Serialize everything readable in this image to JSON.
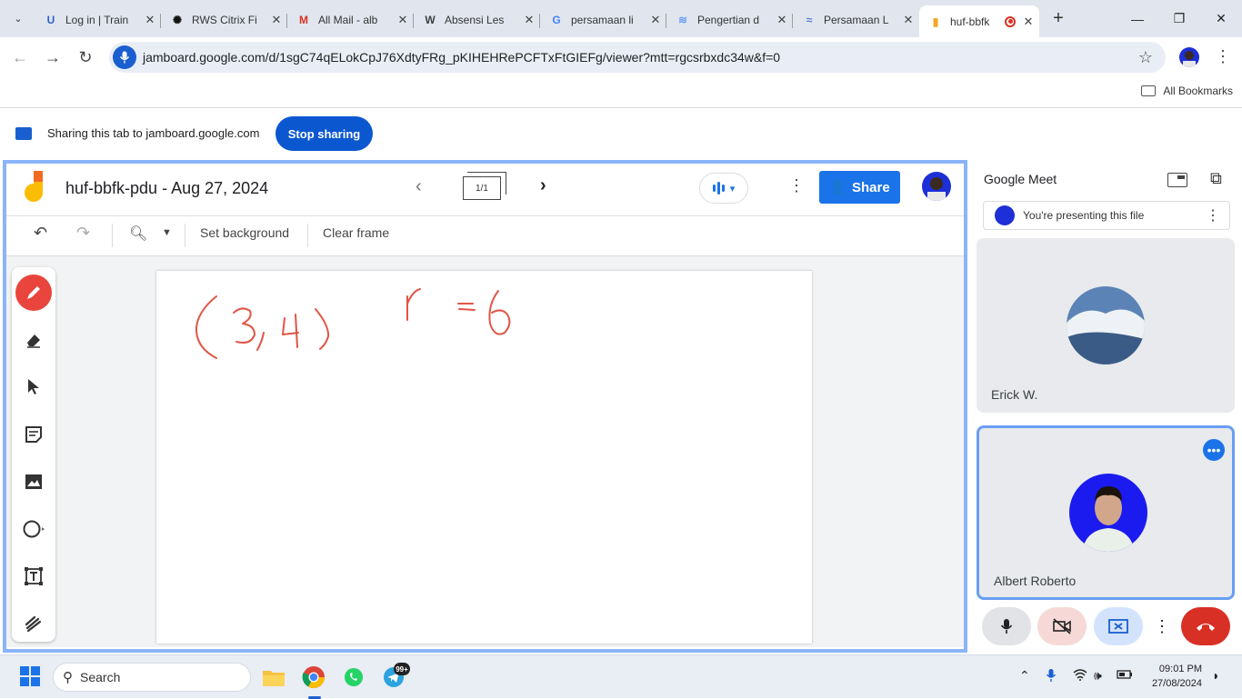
{
  "browser": {
    "tabs": [
      {
        "title": "Log in | Train",
        "favicon": "U",
        "fav_color": "#2f5fd0"
      },
      {
        "title": "RWS Citrix Fi",
        "favicon": "✺",
        "fav_color": "#111111"
      },
      {
        "title": "All Mail - alb",
        "favicon": "M",
        "fav_color": "#d93025"
      },
      {
        "title": "Absensi Les",
        "favicon": "W",
        "fav_color": "#3c4043"
      },
      {
        "title": "persamaan li",
        "favicon": "G",
        "fav_color": "#4285f4"
      },
      {
        "title": "Pengertian d",
        "favicon": "≋",
        "fav_color": "#6a9ef3"
      },
      {
        "title": "Persamaan L",
        "favicon": "≈",
        "fav_color": "#5b7bd0"
      },
      {
        "title": "huf-bbfk",
        "favicon": "▮",
        "fav_color": "#f5a623",
        "active": true
      }
    ],
    "url": "jamboard.google.com/d/1sgC74qELokCpJ76XdtyFRg_pKIHEHRePCFTxFtGIEFg/viewer?mtt=rgcsrbxdc34w&f=0",
    "bookmarks_label": "All Bookmarks"
  },
  "sharing_bar": {
    "text": "Sharing this tab to jamboard.google.com",
    "stop_label": "Stop sharing"
  },
  "jamboard": {
    "title": "huf-bbfk-pdu - Aug 27, 2024",
    "frame_counter": "1/1",
    "share_label": "Share",
    "toolbar": {
      "set_background": "Set background",
      "clear_frame": "Clear frame"
    },
    "tools": [
      "pen",
      "eraser",
      "select",
      "sticky-note",
      "image",
      "circle",
      "text-box",
      "laser"
    ],
    "ink_color": "#e05545"
  },
  "meet": {
    "title": "Google Meet",
    "presenting_text": "You're presenting this file",
    "participants": [
      {
        "name": "Erick W."
      },
      {
        "name": "Albert Roberto",
        "active": true
      }
    ]
  },
  "taskbar": {
    "search_placeholder": "Search",
    "telegram_badge": "99+",
    "time": "09:01 PM",
    "date": "27/08/2024"
  }
}
